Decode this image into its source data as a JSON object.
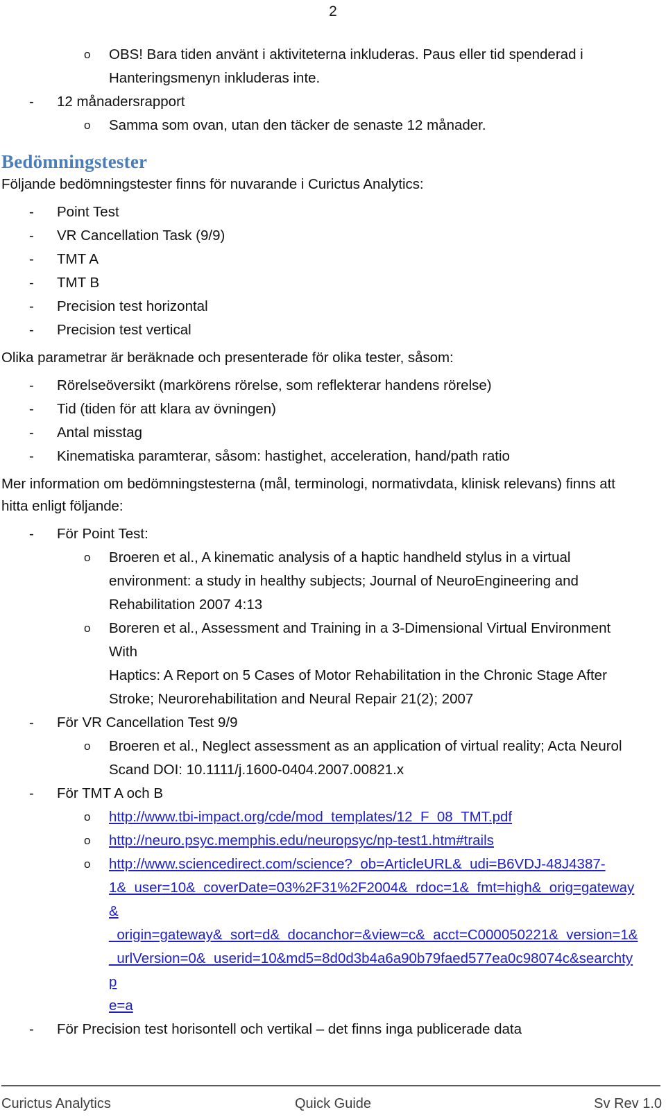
{
  "page": {
    "number": "2"
  },
  "top_list": {
    "note_line1": "OBS! Bara tiden använt i aktiviteterna inkluderas. Paus eller tid spenderad i",
    "note_line2": "Hanteringsmenyn inkluderas inte.",
    "report_item": "12 månadersrapport",
    "report_sub": "Samma som ovan, utan den täcker de senaste 12 månader."
  },
  "section": {
    "heading": "Bedömningstester",
    "intro": "Följande bedömningstester finns för nuvarande i Curictus Analytics:",
    "tests": [
      "Point Test",
      "VR Cancellation Task (9/9)",
      "TMT A",
      "TMT B",
      "Precision test horizontal",
      "Precision test vertical"
    ],
    "params_intro": "Olika parametrar är beräknade och presenterade för olika tester, såsom:",
    "params": [
      "Rörelseöversikt (markörens rörelse, som reflekterar handens rörelse)",
      "Tid (tiden för att klara av övningen)",
      "Antal misstag",
      "Kinematiska paramterar, såsom: hastighet, acceleration, hand/path ratio"
    ],
    "more_info_line1": "Mer information om bedömningstesterna (mål, terminologi, normativdata, klinisk relevans) finns att",
    "more_info_line2": "hitta enligt följande:"
  },
  "references": {
    "point_test_label": "För Point Test:",
    "point_test_refs": [
      {
        "line1": "Broeren et al., A kinematic analysis of a haptic handheld stylus in a virtual",
        "line2": "environment: a study in healthy subjects; Journal of NeuroEngineering and",
        "line3": "Rehabilitation 2007 4:13"
      },
      {
        "line1": "Boreren et al., Assessment and Training in a 3-Dimensional Virtual Environment With",
        "line2": "Haptics: A Report on 5 Cases of Motor Rehabilitation in the Chronic Stage After",
        "line3": "Stroke; Neurorehabilitation and Neural Repair 21(2); 2007"
      }
    ],
    "vr_label": "För VR Cancellation Test 9/9",
    "vr_ref": {
      "line1": "Broeren et al., Neglect assessment as an application of virtual reality; Acta Neurol",
      "line2": "Scand DOI: 10.1111/j.1600-0404.2007.00821.x"
    },
    "tmt_label": "För TMT A och B",
    "tmt_links": [
      "http://www.tbi-impact.org/cde/mod_templates/12_F_08_TMT.pdf",
      "http://neuro.psyc.memphis.edu/neuropsyc/np-test1.htm#trails"
    ],
    "sciencedirect_link_lines": [
      "http://www.sciencedirect.com/science?_ob=ArticleURL&_udi=B6VDJ-48J4387-",
      "1&_user=10&_coverDate=03%2F31%2F2004&_rdoc=1&_fmt=high&_orig=gateway&",
      "_origin=gateway&_sort=d&_docanchor=&view=c&_acct=C000050221&_version=1&",
      "_urlVersion=0&_userid=10&md5=8d0d3b4a6a90b79faed577ea0c98074c&searchtyp",
      "e=a"
    ],
    "precision_label": "För Precision test horisontell och vertikal – det finns inga publicerade data"
  },
  "footer": {
    "left": "Curictus Analytics",
    "center": "Quick Guide",
    "right": "Sv Rev 1.0"
  },
  "colors": {
    "heading": "#4a7ebb",
    "link": "#2020c8",
    "text": "#111111",
    "footer_text": "#3d3d3d"
  }
}
